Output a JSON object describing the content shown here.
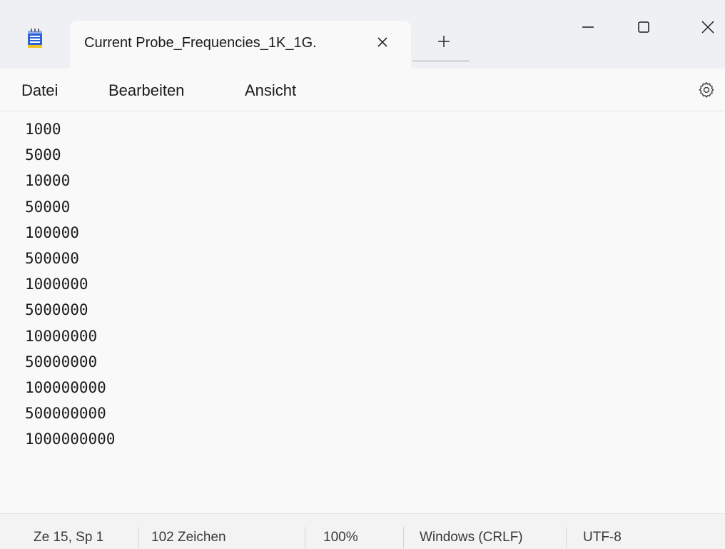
{
  "window": {
    "tab_title": "Current Probe_Frequencies_1K_1G.",
    "close_tab_glyph": "×",
    "new_tab_glyph": "+"
  },
  "menu": {
    "items": [
      "Datei",
      "Bearbeiten",
      "Ansicht"
    ]
  },
  "icons": {
    "app": "notepad-icon",
    "settings": "gear-icon"
  },
  "editor": {
    "lines": [
      "1000",
      "5000",
      "10000",
      "50000",
      "100000",
      "500000",
      "1000000",
      "5000000",
      "10000000",
      "50000000",
      "100000000",
      "500000000",
      "1000000000"
    ]
  },
  "status": {
    "position": "Ze 15, Sp 1",
    "characters": "102 Zeichen",
    "zoom": "100%",
    "line_ending": "Windows (CRLF)",
    "encoding": "UTF-8"
  },
  "colors": {
    "titlebar": "#eef0f3",
    "editor_bg": "#f9f9f9",
    "statusbar": "#f3f3f3",
    "notepad_icon_blue": "#2b63d8",
    "notepad_icon_yellow": "#f5c425"
  }
}
